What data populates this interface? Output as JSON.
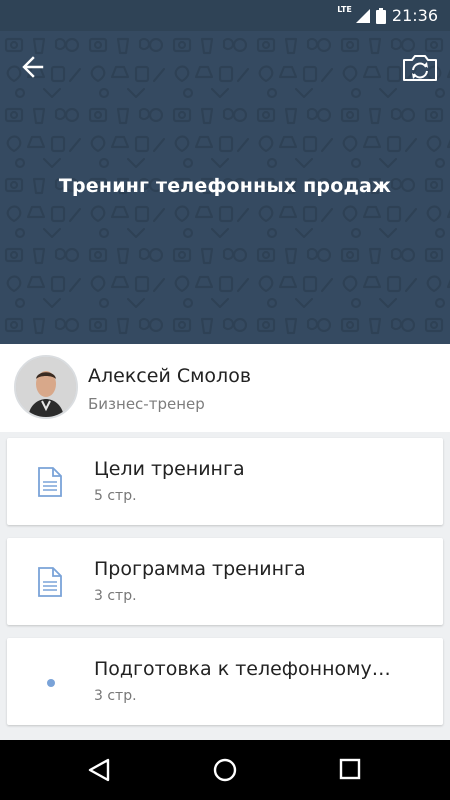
{
  "status_bar": {
    "network": "LTE",
    "time": "21:36",
    "icons": [
      "signal-icon",
      "battery-icon"
    ]
  },
  "header": {
    "title": "Тренинг телефонных продаж",
    "back_icon": "arrow-back-icon",
    "camera_icon": "camera-switch-icon",
    "background_color": "#354a61"
  },
  "author": {
    "name": "Алексей Смолов",
    "role": "Бизнес-тренер"
  },
  "sections": [
    {
      "title": "Цели тренинга",
      "pages": "5 стр.",
      "icon": "document-icon"
    },
    {
      "title": "Программа тренинга",
      "pages": "3 стр.",
      "icon": "document-icon"
    },
    {
      "title": "Подготовка к телефонному…",
      "pages": "3 стр.",
      "icon": "dot-icon"
    }
  ],
  "nav_bar": {
    "icons": [
      "back-triangle-icon",
      "home-circle-icon",
      "recents-square-icon"
    ]
  },
  "colors": {
    "status_bar": "#2f4356",
    "accent_icon": "#7aa3d8",
    "card_bg": "#ffffff",
    "page_bg": "#eef0f2"
  }
}
